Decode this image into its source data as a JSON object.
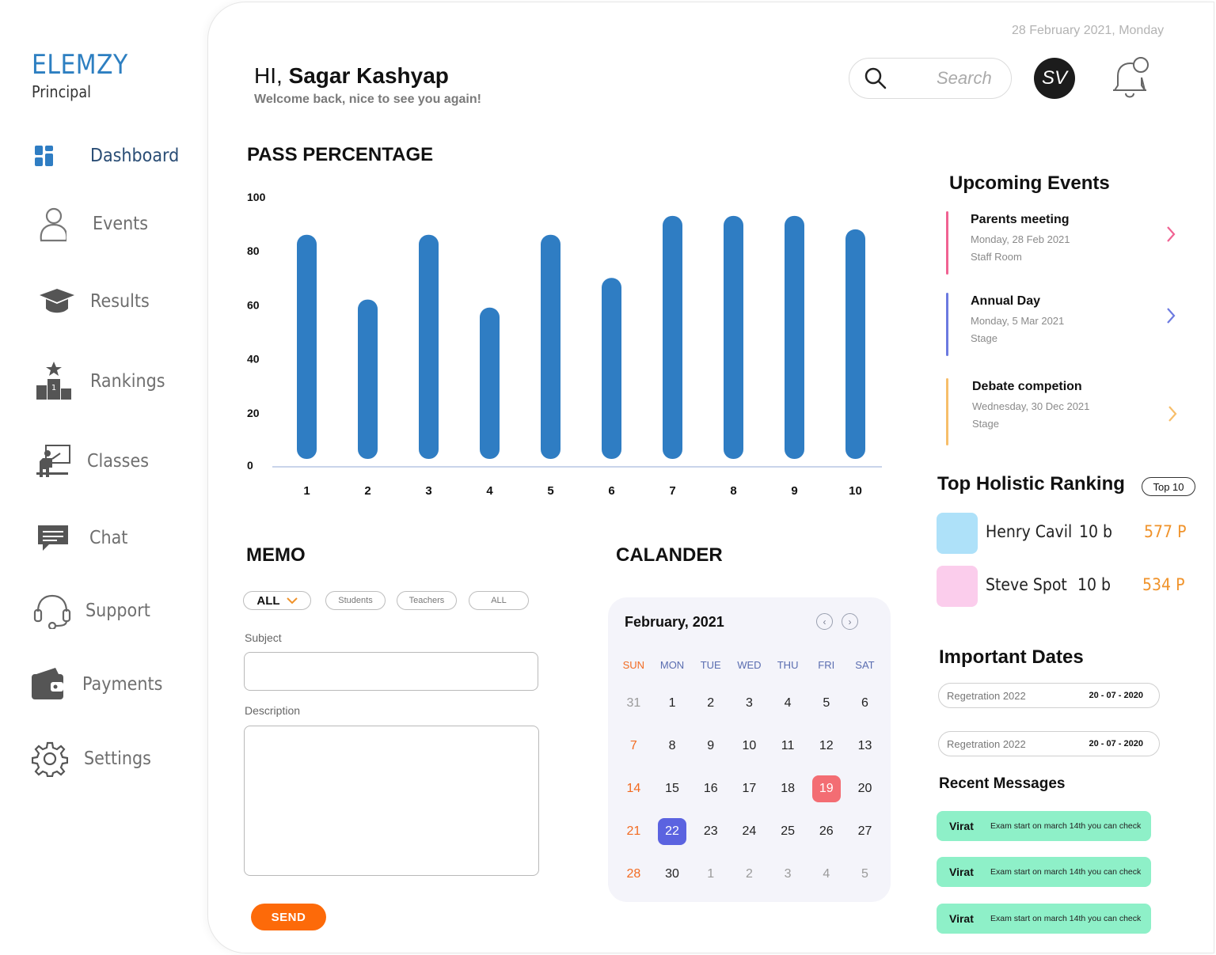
{
  "brand": {
    "name": "ELEMZY",
    "role": "Principal"
  },
  "sidebar": {
    "items": [
      {
        "label": "Dashboard",
        "icon": "dashboard-icon",
        "active": true
      },
      {
        "label": "Events",
        "icon": "user-icon"
      },
      {
        "label": "Results",
        "icon": "graduation-cap-icon"
      },
      {
        "label": "Rankings",
        "icon": "podium-icon"
      },
      {
        "label": "Classes",
        "icon": "teacher-board-icon"
      },
      {
        "label": "Chat",
        "icon": "chat-icon"
      },
      {
        "label": "Support",
        "icon": "headset-icon"
      },
      {
        "label": "Payments",
        "icon": "wallet-icon"
      },
      {
        "label": "Settings",
        "icon": "gear-icon"
      }
    ]
  },
  "header": {
    "date": "28 February 2021, Monday",
    "greeting_prefix": "HI,",
    "user_name": "Sagar Kashyap",
    "welcome": "Welcome back, nice to see you again!",
    "search_placeholder": "Search",
    "avatar_initials": "SV"
  },
  "pass_percentage": {
    "title": "PASS PERCENTAGE"
  },
  "chart_data": {
    "type": "bar",
    "title": "PASS PERCENTAGE",
    "categories": [
      "1",
      "2",
      "3",
      "4",
      "5",
      "6",
      "7",
      "8",
      "9",
      "10"
    ],
    "values": [
      86,
      62,
      86,
      59,
      86,
      70,
      93,
      93,
      93,
      88
    ],
    "yticks": [
      "100",
      "80",
      "60",
      "40",
      "20",
      "0"
    ],
    "ylim": [
      0,
      100
    ],
    "color": "#2f7dc3",
    "grid": false
  },
  "memo": {
    "title": "MEMO",
    "filters": [
      "ALL",
      "Students",
      "Teachers",
      "ALL"
    ],
    "subject_label": "Subject",
    "description_label": "Description",
    "send_label": "SEND"
  },
  "calendar": {
    "title": "CALANDER",
    "month": "February, 2021",
    "weekdays": [
      "SUN",
      "MON",
      "TUE",
      "WED",
      "THU",
      "FRI",
      "SAT"
    ],
    "weeks": [
      [
        "31",
        "1",
        "2",
        "3",
        "4",
        "5",
        "6"
      ],
      [
        "7",
        "8",
        "9",
        "10",
        "11",
        "12",
        "13"
      ],
      [
        "14",
        "15",
        "16",
        "17",
        "18",
        "19",
        "20"
      ],
      [
        "21",
        "22",
        "23",
        "24",
        "25",
        "26",
        "27"
      ],
      [
        "28",
        "30",
        "1",
        "2",
        "3",
        "4",
        "5"
      ]
    ],
    "highlight_red": "19",
    "highlight_blue": "22",
    "colors": {
      "sunday": "#f26b21",
      "red": "#f36d73",
      "blue": "#5b63e0",
      "muted": "#9a9a9a"
    }
  },
  "upcoming_events": {
    "title": "Upcoming Events",
    "items": [
      {
        "title": "Parents meeting",
        "date": "Monday, 28 Feb 2021",
        "place": "Staff Room",
        "color": "#f06292"
      },
      {
        "title": "Annual Day",
        "date": "Monday, 5 Mar 2021",
        "place": "Stage",
        "color": "#6c7ae0"
      },
      {
        "title": "Debate competion",
        "date": "Wednesday, 30 Dec 2021",
        "place": "Stage",
        "color": "#f7be6a"
      }
    ]
  },
  "ranking": {
    "title": "Top Holistic Ranking",
    "badge": "Top 10",
    "items": [
      {
        "name": "Henry Cavil",
        "class": "10 b",
        "points": "577 P",
        "color": "#aee1f9"
      },
      {
        "name": "Steve Spot",
        "class": "10 b",
        "points": "534 P",
        "color": "#fbcdec"
      }
    ]
  },
  "important_dates": {
    "title": "Important Dates",
    "items": [
      {
        "label": "Regetration 2022",
        "date": "20 - 07 - 2020"
      },
      {
        "label": "Regetration 2022",
        "date": "20 - 07 - 2020"
      }
    ]
  },
  "recent_messages": {
    "title": "Recent Messages",
    "items": [
      {
        "from": "Virat",
        "text": "Exam start on march 14th you can check"
      },
      {
        "from": "Virat",
        "text": "Exam start on march 14th you can check"
      },
      {
        "from": "Virat",
        "text": "Exam start on march 14th you can check"
      }
    ]
  }
}
